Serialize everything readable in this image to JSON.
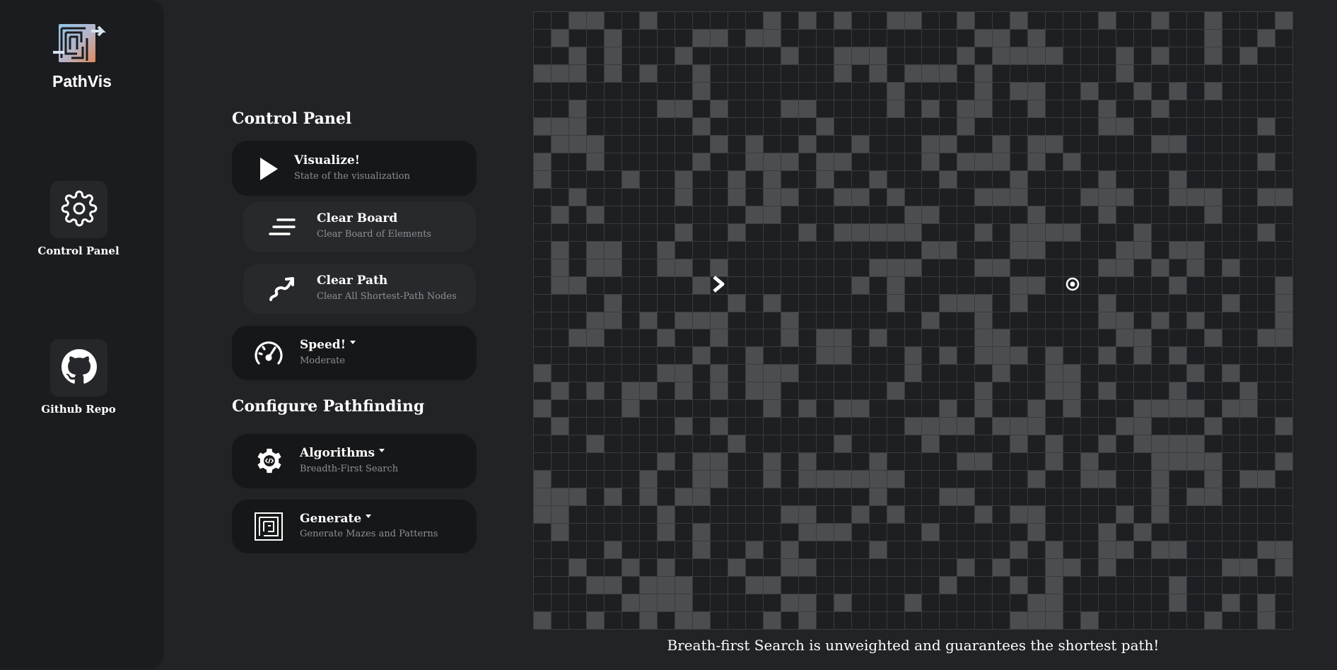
{
  "sidebar": {
    "app_title": "PathVis",
    "control_panel_label": "Control Panel",
    "github_label": "Github Repo"
  },
  "control_panel": {
    "title": "Control Panel",
    "visualize": {
      "label": "Visualize!",
      "sub": "State of the visualization"
    },
    "clear_board": {
      "label": "Clear Board",
      "sub": "Clear Board of Elements"
    },
    "clear_path": {
      "label": "Clear Path",
      "sub": "Clear All Shortest-Path Nodes"
    },
    "speed": {
      "label": "Speed!",
      "sub": "Moderate"
    }
  },
  "configure": {
    "title": "Configure Pathfinding",
    "algorithms": {
      "label": "Algorithms",
      "sub": "Breadth-First Search"
    },
    "generate": {
      "label": "Generate",
      "sub": "Generate Mazes and Patterns"
    }
  },
  "grid": {
    "rows": 35,
    "cols": 43,
    "start_node": {
      "row": 15,
      "col": 10
    },
    "target_node": {
      "row": 15,
      "col": 30
    }
  },
  "caption": "Breath-first Search is unweighted and guarantees the shortest path!",
  "colors": {
    "background": "#222327",
    "sidebar": "#1b1c1f",
    "card_dark": "#161719",
    "card_light": "#28292d",
    "cell": "#1e1f22",
    "wall": "#4c4d51",
    "grid_line": "#3a3b3f"
  },
  "icons": {
    "logo": "pathvis-logo",
    "control_panel": "gear-icon",
    "github": "github-icon",
    "visualize": "play-icon",
    "clear_board": "lines-icon",
    "clear_path": "squiggle-arrow-icon",
    "speed": "speedometer-icon",
    "algorithms": "code-gear-icon",
    "generate": "maze-icon",
    "start": "chevron-right-icon",
    "target": "target-icon"
  }
}
